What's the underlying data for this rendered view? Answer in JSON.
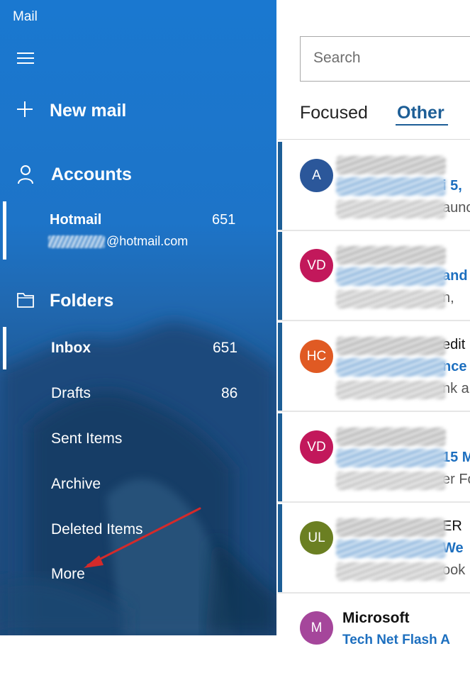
{
  "app": {
    "title": "Mail"
  },
  "nav": {
    "new_mail": "New mail",
    "accounts": "Accounts",
    "folders": "Folders"
  },
  "account": {
    "name": "Hotmail",
    "count": "651",
    "email_domain": "@hotmail.com"
  },
  "folders": [
    {
      "label": "Inbox",
      "count": "651"
    },
    {
      "label": "Drafts",
      "count": "86"
    },
    {
      "label": "Sent Items"
    },
    {
      "label": "Archive"
    },
    {
      "label": "Deleted Items"
    },
    {
      "label": "More"
    }
  ],
  "search": {
    "placeholder": "Search"
  },
  "tabs": {
    "focused": "Focused",
    "other": "Other"
  },
  "messages": [
    {
      "initials": "A",
      "avatar_color": "#2b579a",
      "line1": "",
      "line2": "i 5,",
      "line3": "aunc"
    },
    {
      "initials": "VD",
      "avatar_color": "#c2185b",
      "line1": "",
      "line2": "and",
      "line3": "n,"
    },
    {
      "initials": "HC",
      "avatar_color": "#e05a23",
      "line1": "edit",
      "line2": "nce",
      "line3": "nk a"
    },
    {
      "initials": "VD",
      "avatar_color": "#c2185b",
      "line1": "",
      "line2": "15 M",
      "line3": "er Fo"
    },
    {
      "initials": "UL",
      "avatar_color": "#6b7f22",
      "line1": "ER",
      "line2": "We",
      "line3": "ook"
    },
    {
      "initials": "M",
      "avatar_color": "#a5469b",
      "sender": "Microsoft",
      "subject": "Tech Net Flash A"
    }
  ],
  "colors": {
    "accent": "#1d5e96",
    "sidebar": "#1a72c7",
    "annotation_arrow": "#d42a2a"
  },
  "icons": {
    "menu": "hamburger-icon",
    "new_mail": "plus-icon",
    "accounts": "person-icon",
    "folders": "folder-icon"
  }
}
